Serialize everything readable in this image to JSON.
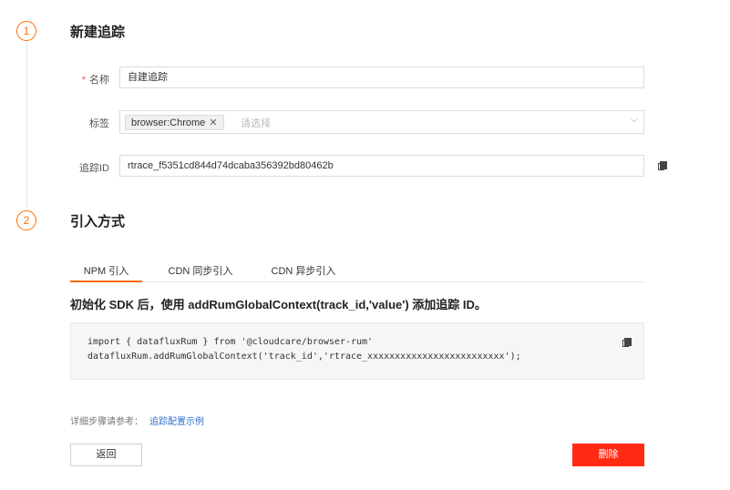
{
  "steps": [
    {
      "number": "1",
      "title": "新建追踪"
    },
    {
      "number": "2",
      "title": "引入方式"
    }
  ],
  "form": {
    "name": {
      "required_mark": "*",
      "label": "名称",
      "value": "自建追踪"
    },
    "tags": {
      "label": "标签",
      "tags": [
        "browser:Chrome"
      ],
      "placeholder": "请选择"
    },
    "track_id": {
      "label": "追踪ID",
      "value": "rtrace_f5351cd844d74dcaba356392bd80462b"
    }
  },
  "tabs": [
    {
      "label": "NPM 引入",
      "active": true
    },
    {
      "label": "CDN 同步引入",
      "active": false
    },
    {
      "label": "CDN 异步引入",
      "active": false
    }
  ],
  "description": "初始化 SDK 后，使用 addRumGlobalContext(track_id,'value') 添加追踪 ID。",
  "code_lines": [
    "import { datafluxRum } from '@cloudcare/browser-rum'",
    "datafluxRum.addRumGlobalContext('track_id','rtrace_xxxxxxxxxxxxxxxxxxxxxxxxx');"
  ],
  "reference": {
    "label": "详细步骤请参考：",
    "link_text": "追踪配置示例"
  },
  "buttons": {
    "back": "返回",
    "delete": "删除"
  },
  "colors": {
    "accent": "#ff6a00",
    "danger": "#ff2a12",
    "link": "#2f6fd1"
  },
  "icons": {
    "copy": "copy-icon",
    "remove_tag": "close-icon",
    "dropdown": "chevron-down-icon"
  }
}
